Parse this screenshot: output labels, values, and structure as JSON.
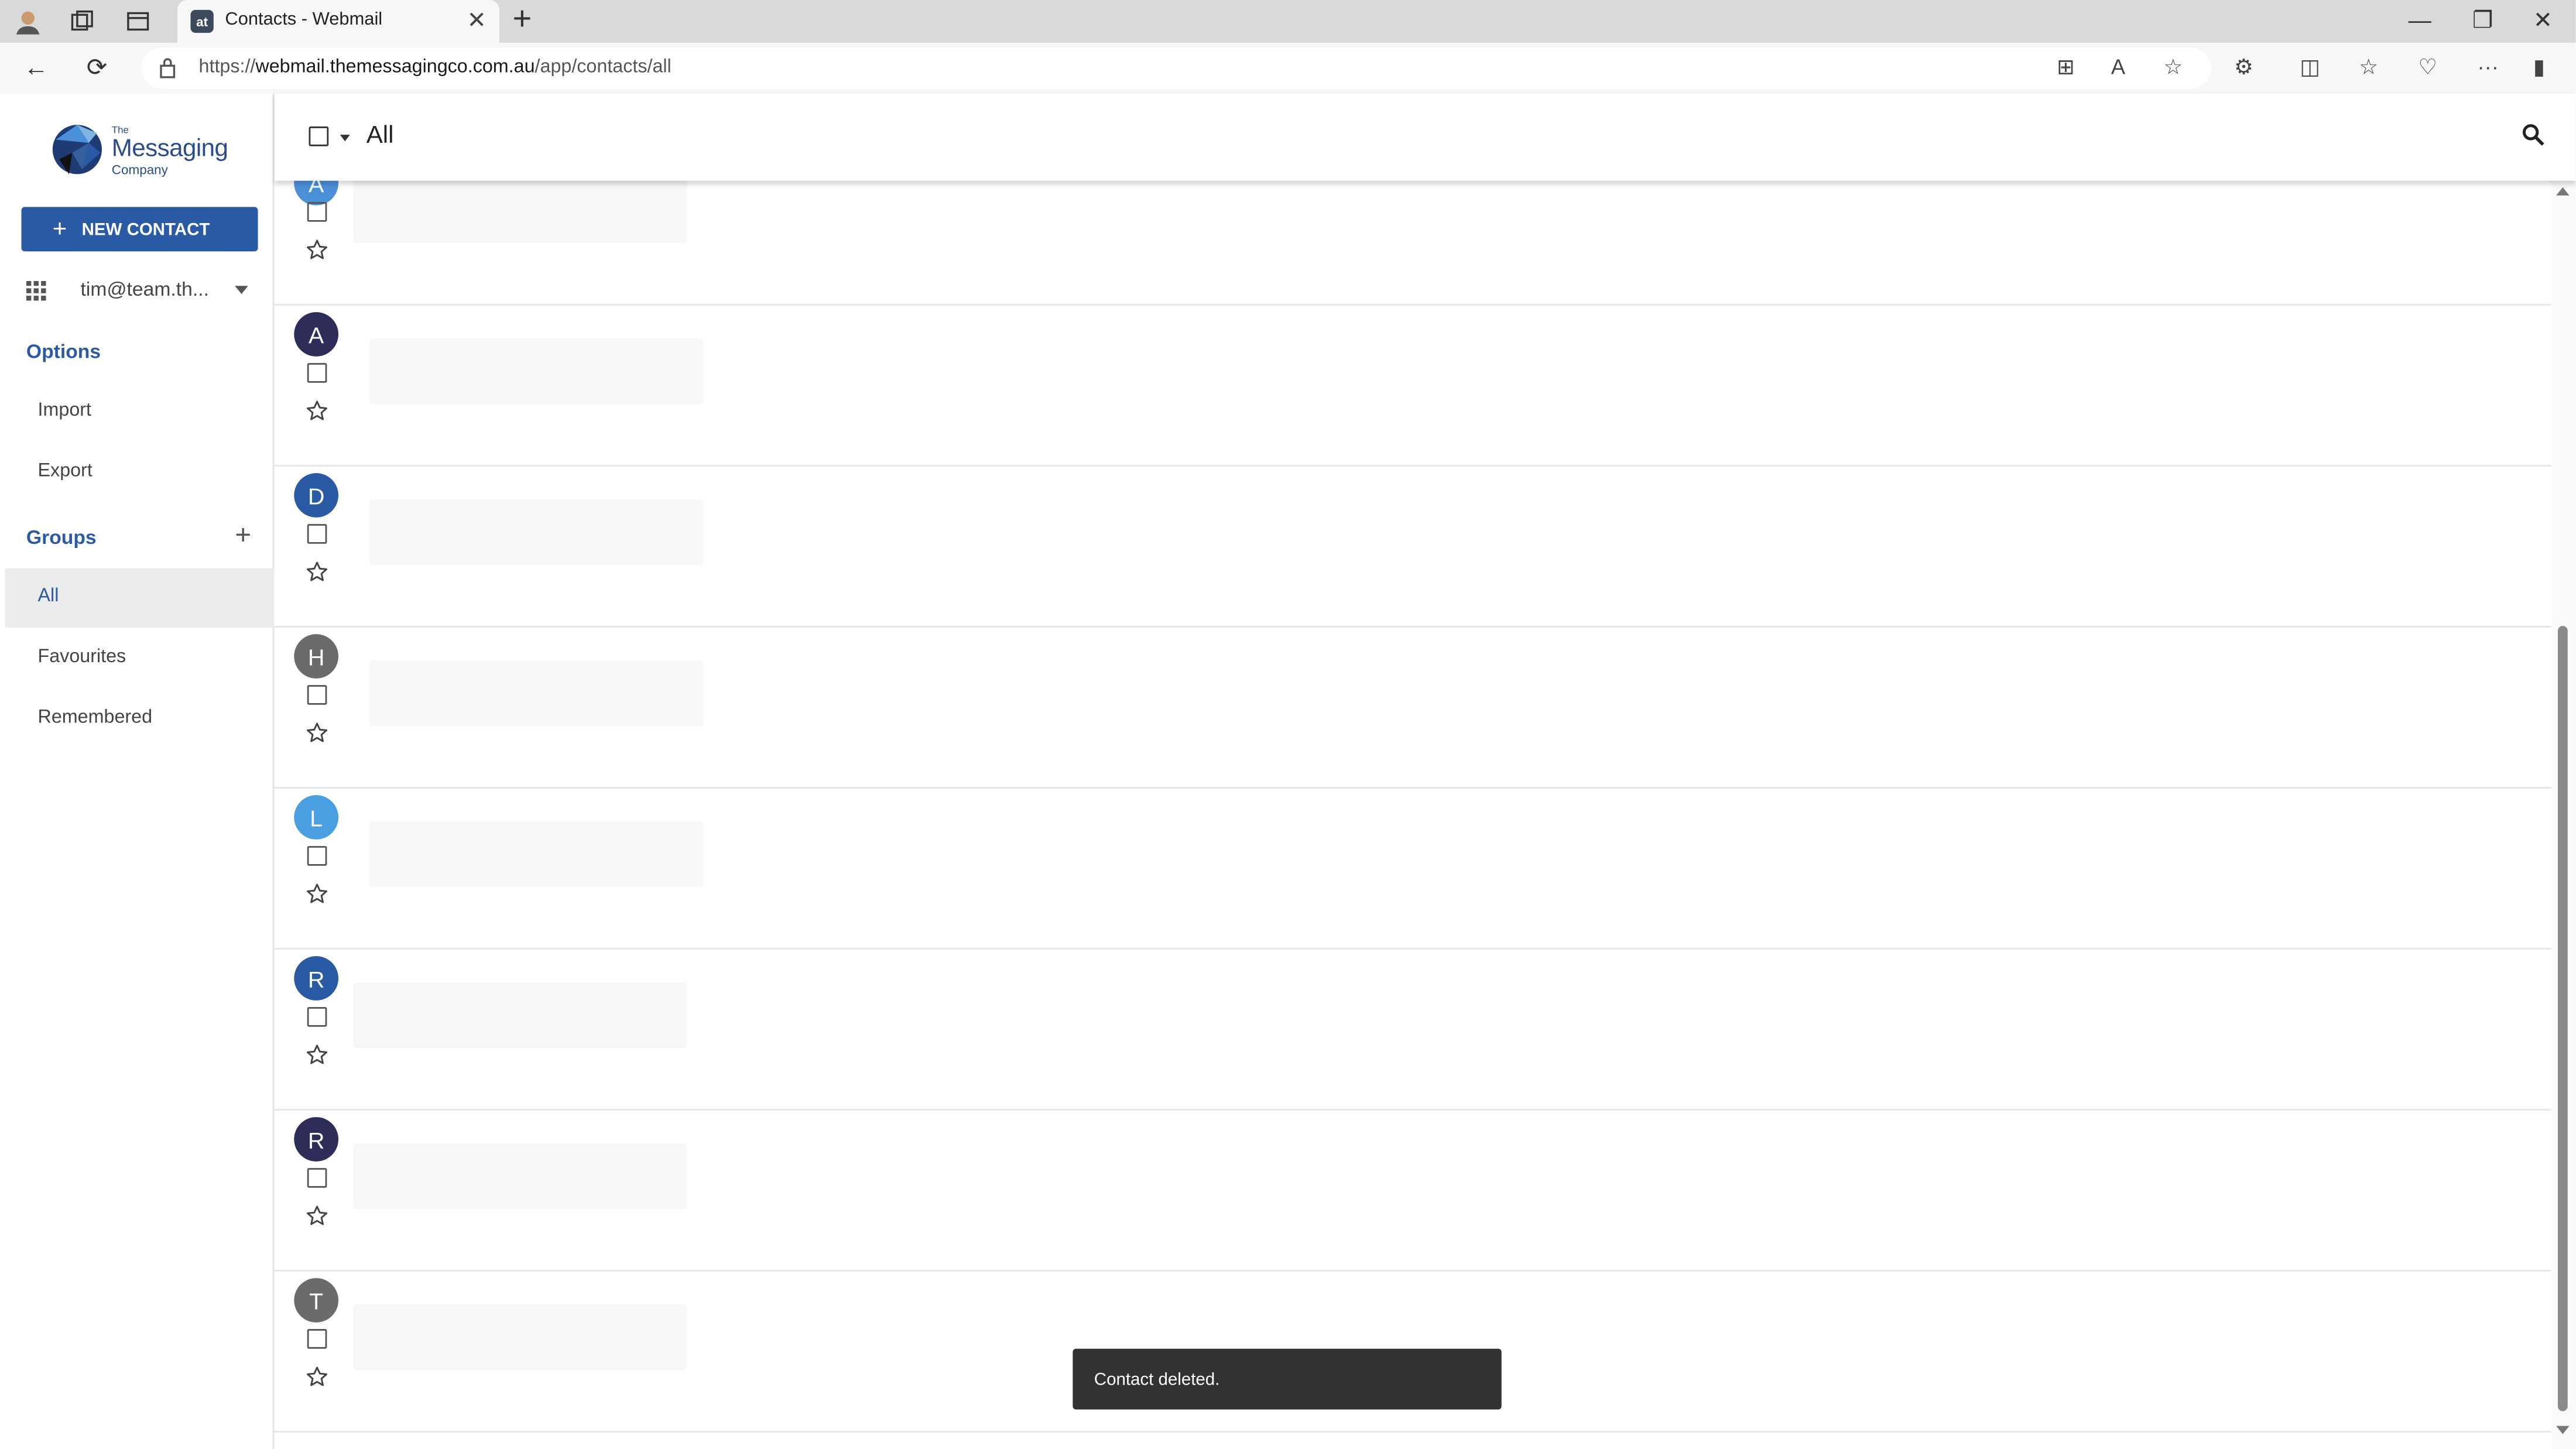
{
  "browser": {
    "tab_title": "Contacts - Webmail",
    "tab_favicon": "at",
    "url_prefix": "https://",
    "url_host": "webmail.themessagingco.com.au",
    "url_path": "/app/contacts/all"
  },
  "sidebar": {
    "logo_small": "The",
    "logo_main": "Messaging",
    "logo_sub": "Company",
    "new_contact_label": "NEW CONTACT",
    "account_email": "tim@team.th...",
    "options_heading": "Options",
    "options_items": [
      "Import",
      "Export"
    ],
    "groups_heading": "Groups",
    "groups_items": [
      "All",
      "Favourites",
      "Remembered"
    ],
    "active_group": "All"
  },
  "toolbar": {
    "title": "All"
  },
  "contacts": [
    {
      "initial": "A",
      "color": "#4a90d9"
    },
    {
      "initial": "A",
      "color": "#2e2d5a"
    },
    {
      "initial": "D",
      "color": "#2b5aa5"
    },
    {
      "initial": "H",
      "color": "#6b6b6b"
    },
    {
      "initial": "L",
      "color": "#4a9fe0"
    },
    {
      "initial": "R",
      "color": "#2b5aa5"
    },
    {
      "initial": "R",
      "color": "#2e2d5a"
    },
    {
      "initial": "T",
      "color": "#6b6b6b"
    }
  ],
  "toast": {
    "message": "Contact deleted."
  },
  "colors": {
    "accent": "#2b5aa5"
  }
}
